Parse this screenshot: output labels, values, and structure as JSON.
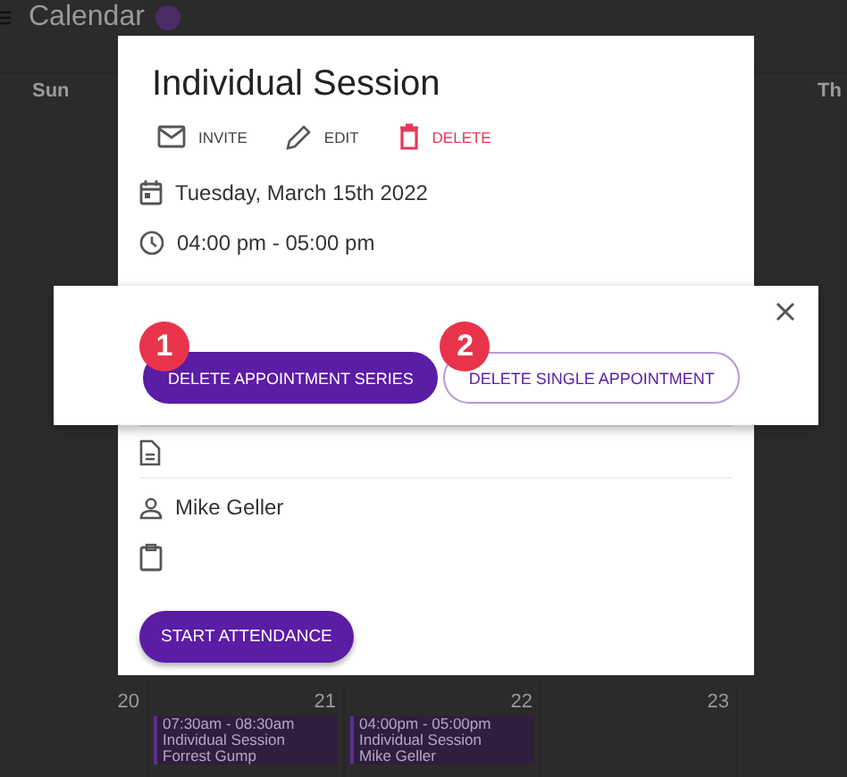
{
  "calendar": {
    "title": "Calendar",
    "weekdays": [
      "Sun",
      "Th"
    ],
    "dates": [
      "20",
      "21",
      "22",
      "23"
    ],
    "events": [
      {
        "time": "07:30am - 08:30am",
        "title": "Individual Session",
        "client": "Forrest Gump"
      },
      {
        "time": "04:00pm - 05:00pm",
        "title": "Individual Session",
        "client": "Mike Geller"
      }
    ]
  },
  "session_dialog": {
    "title": "Individual Session",
    "actions": [
      {
        "kind": "invite",
        "label": "INVITE"
      },
      {
        "kind": "edit",
        "label": "EDIT"
      },
      {
        "kind": "delete",
        "label": "DELETE"
      }
    ],
    "date": "Tuesday, March 15th 2022",
    "time": "04:00 pm - 05:00 pm",
    "client": "Mike Geller",
    "primary_button": "START ATTENDANCE"
  },
  "delete_dialog": {
    "buttons": [
      {
        "label": "DELETE APPOINTMENT SERIES",
        "marker": "1",
        "kind": "filled"
      },
      {
        "label": "DELETE SINGLE APPOINTMENT",
        "marker": "2",
        "kind": "outlined"
      }
    ]
  }
}
